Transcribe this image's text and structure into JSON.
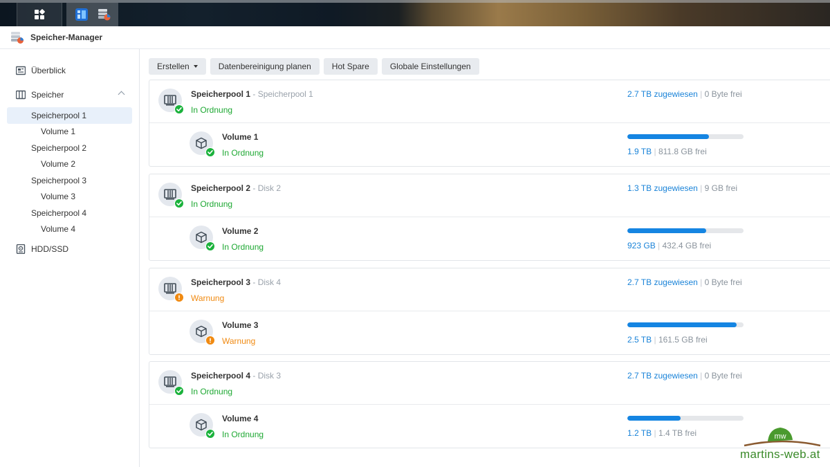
{
  "window": {
    "title": "Speicher-Manager"
  },
  "toolbar": {
    "create_label": "Erstellen",
    "scrub_label": "Datenbereinigung planen",
    "hotspare_label": "Hot Spare",
    "global_label": "Globale Einstellungen"
  },
  "sidebar": {
    "overview": "Überblick",
    "storage": "Speicher",
    "items": [
      {
        "label": "Speicherpool 1",
        "type": "pool",
        "selected": true
      },
      {
        "label": "Volume 1",
        "type": "volume"
      },
      {
        "label": "Speicherpool 2",
        "type": "pool"
      },
      {
        "label": "Volume 2",
        "type": "volume"
      },
      {
        "label": "Speicherpool 3",
        "type": "pool"
      },
      {
        "label": "Volume 3",
        "type": "volume"
      },
      {
        "label": "Speicherpool 4",
        "type": "pool"
      },
      {
        "label": "Volume 4",
        "type": "volume"
      }
    ],
    "hdd": "HDD/SSD"
  },
  "pools": [
    {
      "name": "Speicherpool 1",
      "sep": " - ",
      "sub": "Speicherpool 1",
      "status": "In Ordnung",
      "status_kind": "ok",
      "assigned": "2.7 TB zugewiesen",
      "free": "0 Byte frei",
      "volume": {
        "name": "Volume 1",
        "status": "In Ordnung",
        "status_kind": "ok",
        "used": "1.9 TB",
        "free": "811.8 GB frei",
        "usage_fraction": 0.7
      }
    },
    {
      "name": "Speicherpool 2",
      "sep": " - ",
      "sub": "Disk 2",
      "status": "In Ordnung",
      "status_kind": "ok",
      "assigned": "1.3 TB zugewiesen",
      "free": "9 GB frei",
      "volume": {
        "name": "Volume 2",
        "status": "In Ordnung",
        "status_kind": "ok",
        "used": "923 GB",
        "free": "432.4 GB frei",
        "usage_fraction": 0.68
      }
    },
    {
      "name": "Speicherpool 3",
      "sep": " - ",
      "sub": "Disk 4",
      "status": "Warnung",
      "status_kind": "warn",
      "assigned": "2.7 TB zugewiesen",
      "free": "0 Byte frei",
      "volume": {
        "name": "Volume 3",
        "status": "Warnung",
        "status_kind": "warn",
        "used": "2.5 TB",
        "free": "161.5 GB frei",
        "usage_fraction": 0.94
      }
    },
    {
      "name": "Speicherpool 4",
      "sep": " - ",
      "sub": "Disk 3",
      "status": "In Ordnung",
      "status_kind": "ok",
      "assigned": "2.7 TB zugewiesen",
      "free": "0 Byte frei",
      "volume": {
        "name": "Volume 4",
        "status": "In Ordnung",
        "status_kind": "ok",
        "used": "1.2 TB",
        "free": "1.4 TB frei",
        "usage_fraction": 0.46
      }
    }
  ],
  "colors": {
    "accent": "#1a83d8",
    "ok": "#1da832",
    "warn": "#f08a12",
    "bar": "#1585e2"
  },
  "watermark": {
    "text": "martins-web.at",
    "logo_text": "mw"
  }
}
